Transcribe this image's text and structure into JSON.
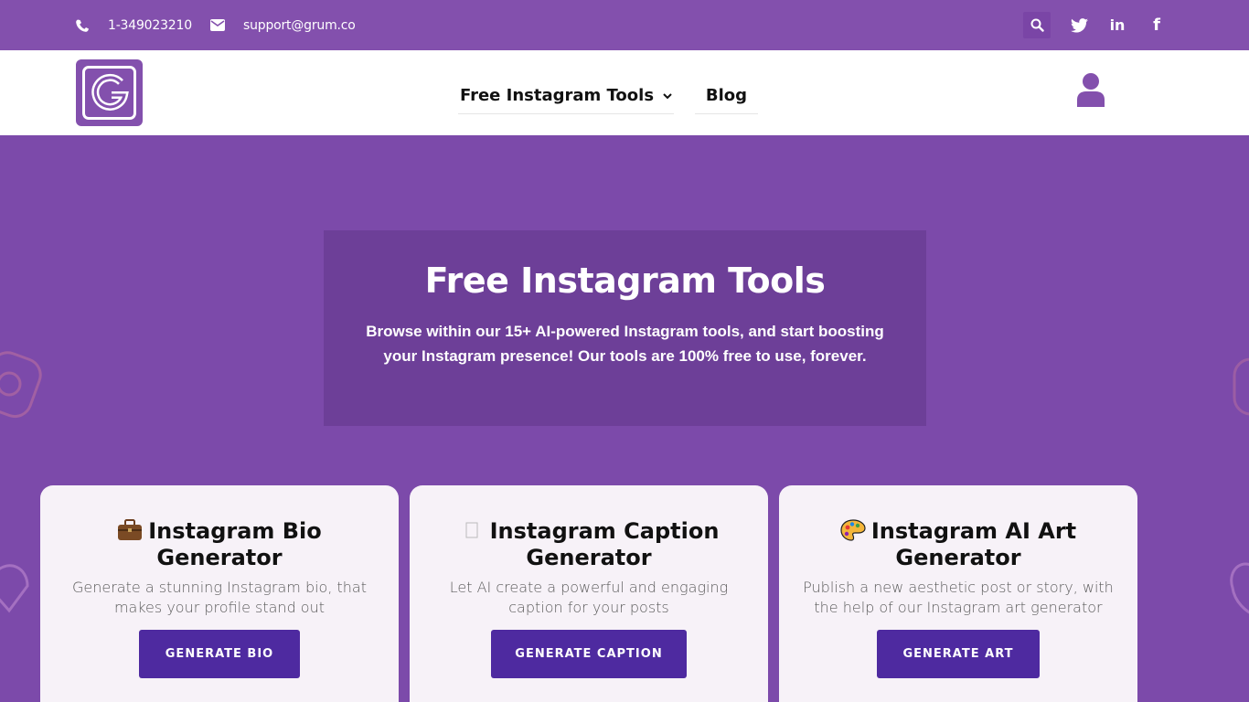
{
  "topbar": {
    "phone": "1-349023210",
    "email": "support@grum.co",
    "icons": [
      "search-icon",
      "twitter-icon",
      "linkedin-icon",
      "facebook-icon"
    ],
    "linkedin_text": "in",
    "facebook_text": "f"
  },
  "header": {
    "logo_letter": "G",
    "nav": [
      {
        "label": "Free Instagram Tools",
        "has_dropdown": true
      },
      {
        "label": "Blog",
        "has_dropdown": false
      }
    ],
    "user_icon": "user-icon"
  },
  "hero": {
    "title": "Free Instagram Tools",
    "description": "Browse within our 15+ AI-powered Instagram tools, and start boosting your Instagram presence! Our tools are 100% free to use, forever."
  },
  "cards": [
    {
      "emoji": "briefcase-icon",
      "title": "Instagram Bio Generator",
      "description": "Generate a stunning Instagram bio, that makes your profile stand out",
      "button": "GENERATE BIO"
    },
    {
      "emoji": "caption-icon",
      "title": "Instagram Caption Generator",
      "description": "Let AI create a powerful and engaging caption for your posts",
      "button": "GENERATE CAPTION"
    },
    {
      "emoji": "palette-icon",
      "title": "Instagram AI Art Generator",
      "description": "Publish a new aesthetic post or story, with the help of our Instagram art generator",
      "button": "GENERATE ART"
    }
  ],
  "colors": {
    "brand_purple": "#8350ad",
    "button_purple": "#4e2aa0",
    "card_bg": "#f7f2f8"
  }
}
